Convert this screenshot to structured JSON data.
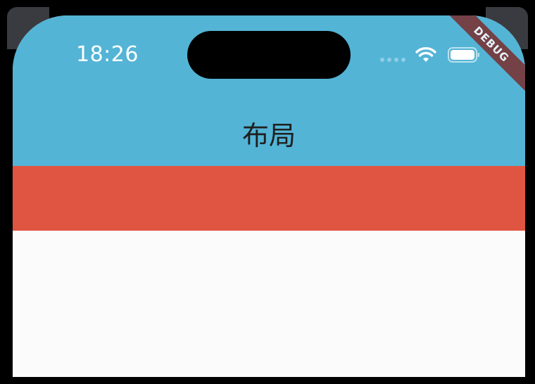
{
  "status_bar": {
    "time": "18:26",
    "wifi_icon": "wifi-icon",
    "battery_icon": "battery-icon",
    "signal_icon": "cellular-signal-icon"
  },
  "app_bar": {
    "title": "布局",
    "background_color": "#53b4d6"
  },
  "body": {
    "red_container_color": "#e05541",
    "background_color": "#fbfbfb"
  },
  "debug_banner": {
    "label": "DEBUG",
    "color": "#7b2d2d"
  }
}
